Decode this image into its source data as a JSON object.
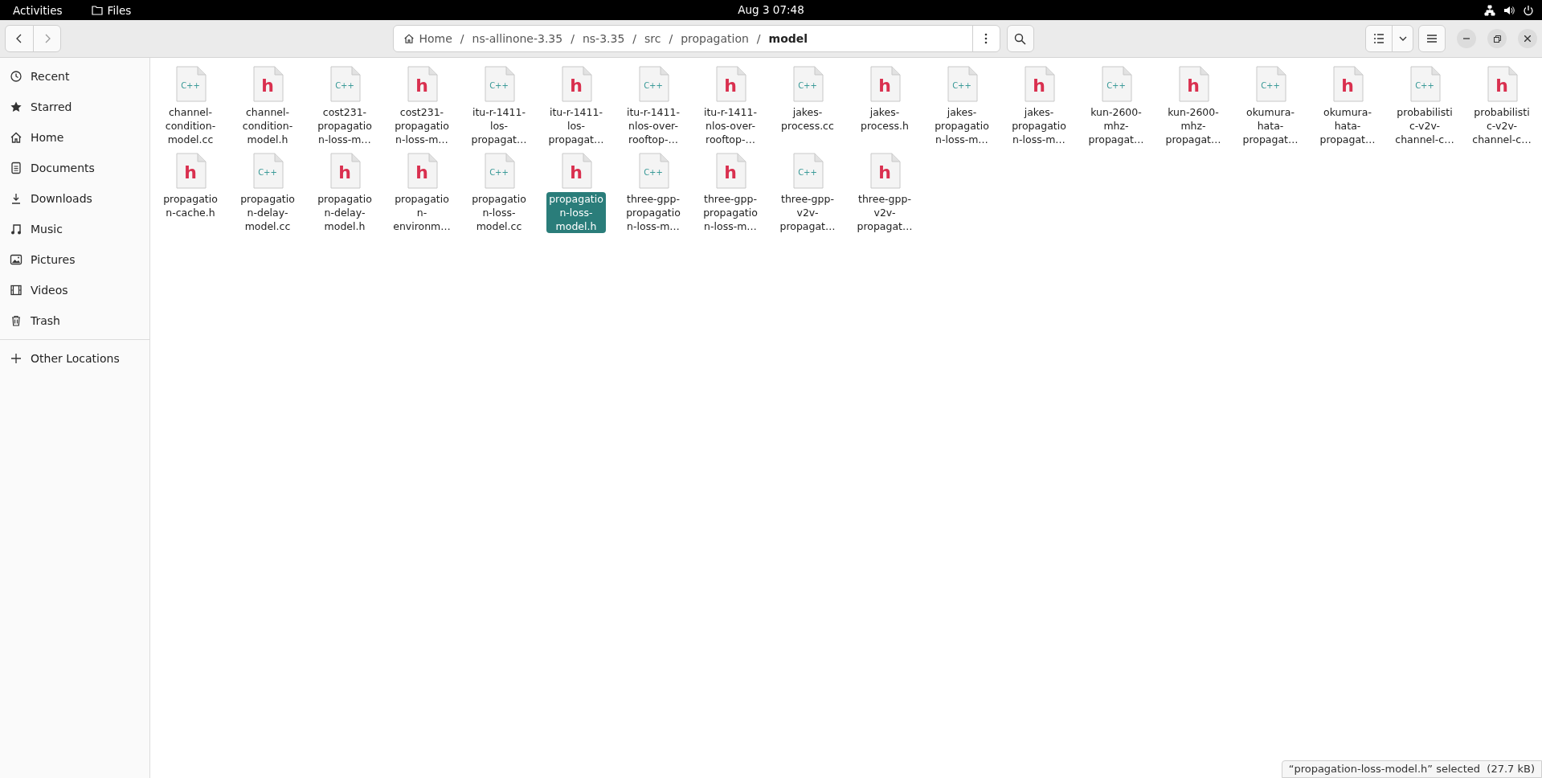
{
  "top_bar": {
    "activities": "Activities",
    "app_name": "Files",
    "clock": "Aug 3  07:48"
  },
  "path_bar": {
    "crumbs": [
      {
        "label": "Home",
        "kind": "home",
        "current": false
      },
      {
        "label": "ns-allinone-3.35",
        "kind": "folder",
        "separator": "/",
        "current": false
      },
      {
        "label": "ns-3.35",
        "kind": "folder",
        "separator": "/",
        "current": false
      },
      {
        "label": "src",
        "kind": "folder",
        "separator": "/",
        "current": false
      },
      {
        "label": "propagation",
        "kind": "folder",
        "separator": "/",
        "current": false
      },
      {
        "label": "model",
        "kind": "folder",
        "separator": "/",
        "current": true
      }
    ]
  },
  "sidebar": {
    "items": [
      {
        "label": "Recent",
        "kind": "recent"
      },
      {
        "label": "Starred",
        "kind": "starred"
      },
      {
        "label": "Home",
        "kind": "home"
      },
      {
        "label": "Documents",
        "kind": "documents"
      },
      {
        "label": "Downloads",
        "kind": "downloads"
      },
      {
        "label": "Music",
        "kind": "music"
      },
      {
        "label": "Pictures",
        "kind": "pictures"
      },
      {
        "label": "Videos",
        "kind": "videos"
      },
      {
        "label": "Trash",
        "kind": "trash"
      }
    ],
    "other": {
      "label": "Other Locations",
      "kind": "plus"
    }
  },
  "files": [
    {
      "kind": "cc",
      "badge": "C++",
      "lines": [
        "channel-",
        "condition-",
        "model.cc"
      ],
      "selected": false
    },
    {
      "kind": "h",
      "badge": "h",
      "lines": [
        "channel-",
        "condition-",
        "model.h"
      ],
      "selected": false
    },
    {
      "kind": "cc",
      "badge": "C++",
      "lines": [
        "cost231-",
        "propagatio",
        "n-loss-m…"
      ],
      "selected": false
    },
    {
      "kind": "h",
      "badge": "h",
      "lines": [
        "cost231-",
        "propagatio",
        "n-loss-m…"
      ],
      "selected": false
    },
    {
      "kind": "cc",
      "badge": "C++",
      "lines": [
        "itu-r-1411-",
        "los-",
        "propagat…"
      ],
      "selected": false
    },
    {
      "kind": "h",
      "badge": "h",
      "lines": [
        "itu-r-1411-",
        "los-",
        "propagat…"
      ],
      "selected": false
    },
    {
      "kind": "cc",
      "badge": "C++",
      "lines": [
        "itu-r-1411-",
        "nlos-over-",
        "rooftop-…"
      ],
      "selected": false
    },
    {
      "kind": "h",
      "badge": "h",
      "lines": [
        "itu-r-1411-",
        "nlos-over-",
        "rooftop-…"
      ],
      "selected": false
    },
    {
      "kind": "cc",
      "badge": "C++",
      "lines": [
        "jakes-",
        "process.cc"
      ],
      "selected": false
    },
    {
      "kind": "h",
      "badge": "h",
      "lines": [
        "jakes-",
        "process.h"
      ],
      "selected": false
    },
    {
      "kind": "cc",
      "badge": "C++",
      "lines": [
        "jakes-",
        "propagatio",
        "n-loss-m…"
      ],
      "selected": false
    },
    {
      "kind": "h",
      "badge": "h",
      "lines": [
        "jakes-",
        "propagatio",
        "n-loss-m…"
      ],
      "selected": false
    },
    {
      "kind": "cc",
      "badge": "C++",
      "lines": [
        "kun-2600-",
        "mhz-",
        "propagat…"
      ],
      "selected": false
    },
    {
      "kind": "h",
      "badge": "h",
      "lines": [
        "kun-2600-",
        "mhz-",
        "propagat…"
      ],
      "selected": false
    },
    {
      "kind": "cc",
      "badge": "C++",
      "lines": [
        "okumura-",
        "hata-",
        "propagat…"
      ],
      "selected": false
    },
    {
      "kind": "h",
      "badge": "h",
      "lines": [
        "okumura-",
        "hata-",
        "propagat…"
      ],
      "selected": false
    },
    {
      "kind": "cc",
      "badge": "C++",
      "lines": [
        "probabilisti",
        "c-v2v-",
        "channel-c…"
      ],
      "selected": false
    },
    {
      "kind": "h",
      "badge": "h",
      "lines": [
        "probabilisti",
        "c-v2v-",
        "channel-c…"
      ],
      "selected": false
    },
    {
      "kind": "h",
      "badge": "h",
      "lines": [
        "propagatio",
        "n-cache.h"
      ],
      "selected": false
    },
    {
      "kind": "cc",
      "badge": "C++",
      "lines": [
        "propagatio",
        "n-delay-",
        "model.cc"
      ],
      "selected": false
    },
    {
      "kind": "h",
      "badge": "h",
      "lines": [
        "propagatio",
        "n-delay-",
        "model.h"
      ],
      "selected": false
    },
    {
      "kind": "h",
      "badge": "h",
      "lines": [
        "propagatio",
        "n-",
        "environm…"
      ],
      "selected": false
    },
    {
      "kind": "cc",
      "badge": "C++",
      "lines": [
        "propagatio",
        "n-loss-",
        "model.cc"
      ],
      "selected": false
    },
    {
      "kind": "h",
      "badge": "h",
      "lines": [
        "propagatio",
        "n-loss-",
        "model.h"
      ],
      "selected": true
    },
    {
      "kind": "cc",
      "badge": "C++",
      "lines": [
        "three-gpp-",
        "propagatio",
        "n-loss-m…"
      ],
      "selected": false
    },
    {
      "kind": "h",
      "badge": "h",
      "lines": [
        "three-gpp-",
        "propagatio",
        "n-loss-m…"
      ],
      "selected": false
    },
    {
      "kind": "cc",
      "badge": "C++",
      "lines": [
        "three-gpp-",
        "v2v-",
        "propagat…"
      ],
      "selected": false
    },
    {
      "kind": "h",
      "badge": "h",
      "lines": [
        "three-gpp-",
        "v2v-",
        "propagat…"
      ],
      "selected": false
    }
  ],
  "status_bar": {
    "text": "“propagation-loss-model.h” selected  (27.7 kB)"
  }
}
